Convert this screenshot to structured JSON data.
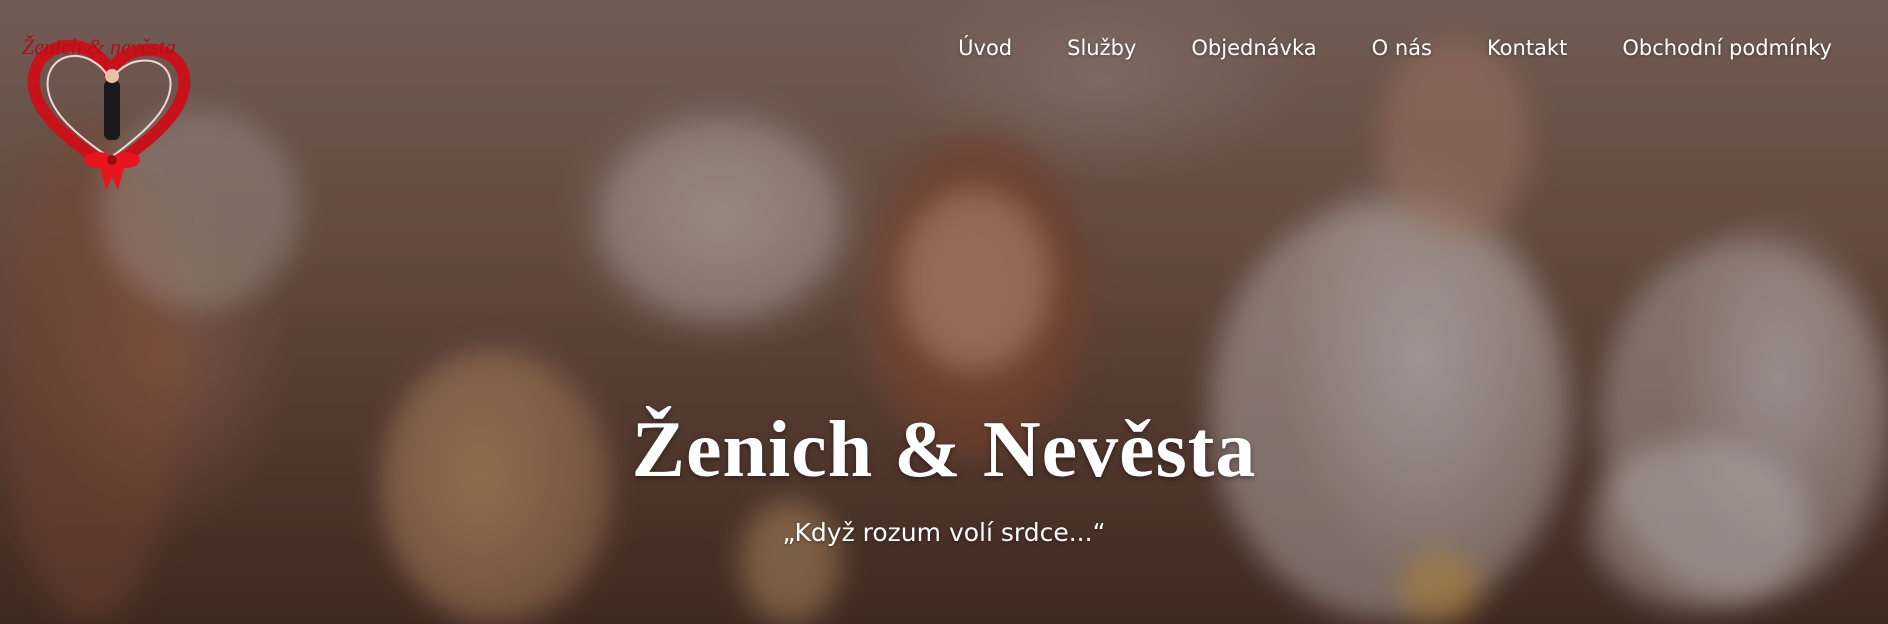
{
  "nav": {
    "items": [
      {
        "label": "Úvod"
      },
      {
        "label": "Služby"
      },
      {
        "label": "Objednávka"
      },
      {
        "label": "O nás"
      },
      {
        "label": "Kontakt"
      },
      {
        "label": "Obchodní podmínky"
      }
    ]
  },
  "hero": {
    "title": "Ženich & Nevěsta",
    "subtitle": "„Když rozum volí srdce...“"
  },
  "logo": {
    "icon": "heart-bow-logo-icon",
    "colors": {
      "heart": "#d0121c",
      "ribbon": "#e8151f"
    }
  }
}
